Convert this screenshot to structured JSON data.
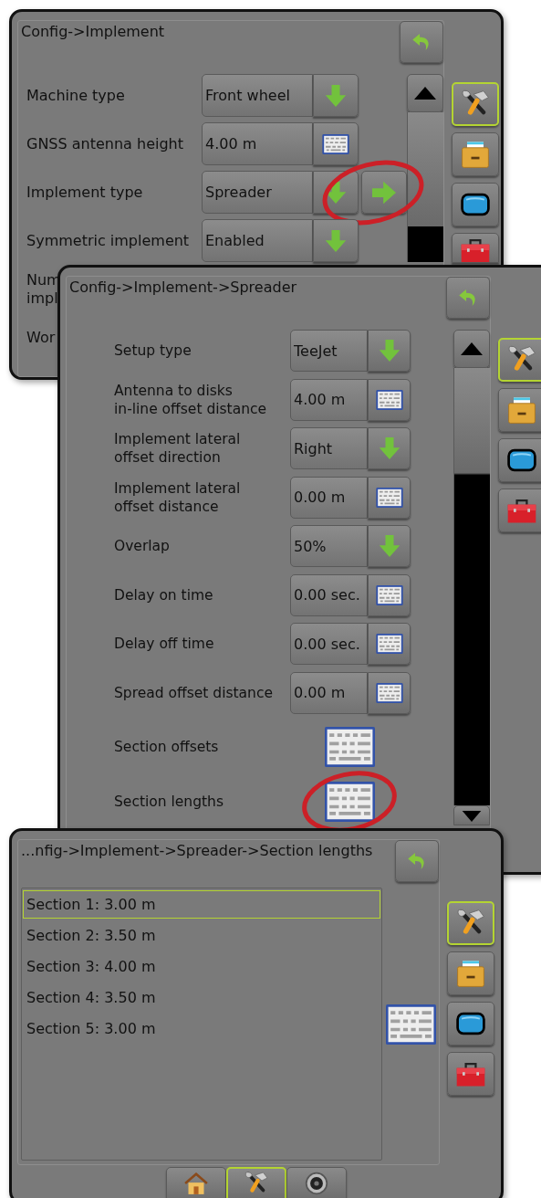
{
  "screens": [
    {
      "kind": "settings",
      "title": "Config->Implement",
      "rows": [
        {
          "kind": "dropdown",
          "label_lines": [
            "Machine type"
          ],
          "value": "Front wheel"
        },
        {
          "kind": "keyboard",
          "label_lines": [
            "GNSS antenna height"
          ],
          "value": "4.00 m"
        },
        {
          "kind": "dropdown",
          "label_lines": [
            "Implement type"
          ],
          "value": "Spreader",
          "next": true,
          "highlighted": true
        },
        {
          "kind": "dropdown",
          "label_lines": [
            "Symmetric implement"
          ],
          "value": "Enabled"
        },
        {
          "kind": "partial",
          "label_lines": [
            "Num",
            "impl"
          ]
        },
        {
          "kind": "partial",
          "label_lines": [
            "Wor"
          ]
        }
      ],
      "side_tabs": [
        {
          "kind": "tools",
          "selected": true
        },
        {
          "kind": "storage",
          "selected": false
        },
        {
          "kind": "display",
          "selected": false
        },
        {
          "kind": "toolbox",
          "selected": false
        }
      ]
    },
    {
      "kind": "settings",
      "title": "Config->Implement->Spreader",
      "rows": [
        {
          "kind": "dropdown",
          "label_lines": [
            "Setup type"
          ],
          "value": "TeeJet"
        },
        {
          "kind": "keyboard",
          "label_lines": [
            "Antenna to disks",
            "in-line offset distance"
          ],
          "value": "4.00 m"
        },
        {
          "kind": "dropdown",
          "label_lines": [
            "Implement lateral",
            "offset direction"
          ],
          "value": "Right"
        },
        {
          "kind": "keyboard",
          "label_lines": [
            "Implement lateral",
            "offset distance"
          ],
          "value": "0.00 m"
        },
        {
          "kind": "dropdown",
          "label_lines": [
            "Overlap"
          ],
          "value": "50%"
        },
        {
          "kind": "keyboard",
          "label_lines": [
            "Delay on time"
          ],
          "value": "0.00 sec."
        },
        {
          "kind": "keyboard",
          "label_lines": [
            "Delay off time"
          ],
          "value": "0.00 sec."
        },
        {
          "kind": "keyboard",
          "label_lines": [
            "Spread offset distance"
          ],
          "value": "0.00 m"
        },
        {
          "kind": "keyboard_only",
          "label_lines": [
            "Section offsets"
          ]
        },
        {
          "kind": "keyboard_only",
          "label_lines": [
            "Section lengths"
          ],
          "highlighted": true
        }
      ],
      "side_tabs": [
        {
          "kind": "tools",
          "selected": true
        },
        {
          "kind": "storage",
          "selected": false
        },
        {
          "kind": "display",
          "selected": false
        },
        {
          "kind": "toolbox",
          "selected": false
        }
      ]
    },
    {
      "kind": "list",
      "title": "...nfig->Implement->Spreader->Section lengths",
      "items": [
        {
          "text": "Section 1: 3.00 m",
          "selected": true
        },
        {
          "text": "Section 2: 3.50 m",
          "selected": false
        },
        {
          "text": "Section 3: 4.00 m",
          "selected": false
        },
        {
          "text": "Section 4: 3.50 m",
          "selected": false
        },
        {
          "text": "Section 5: 3.00 m",
          "selected": false
        }
      ],
      "side_tabs": [
        {
          "kind": "tools",
          "selected": true
        },
        {
          "kind": "storage",
          "selected": false
        },
        {
          "kind": "display",
          "selected": false
        },
        {
          "kind": "toolbox",
          "selected": false
        }
      ],
      "bottom_tabs": [
        {
          "kind": "home",
          "selected": false
        },
        {
          "kind": "tools",
          "selected": true
        },
        {
          "kind": "camera",
          "selected": false
        }
      ]
    }
  ]
}
